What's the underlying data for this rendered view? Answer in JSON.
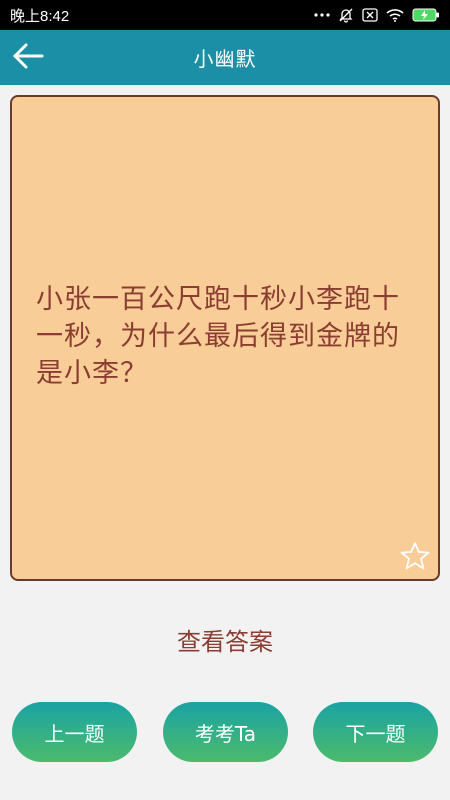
{
  "status_bar": {
    "time": "晚上8:42",
    "icons": [
      "dots-icon",
      "mute-bell-icon",
      "x-box-icon",
      "wifi-icon",
      "battery-charging-icon"
    ]
  },
  "header": {
    "title": "小幽默",
    "back_icon": "back-arrow-icon",
    "color": "#1b8fa6"
  },
  "card": {
    "question": "小张一百公尺跑十秒小李跑十一秒，为什么最后得到金牌的是小李？",
    "background": "#f8cd98",
    "text_color": "#8b3d31",
    "favorite_icon": "star-icon"
  },
  "answer_link": "查看答案",
  "buttons": {
    "prev": "上一题",
    "quiz": "考考Ta",
    "next": "下一题"
  }
}
